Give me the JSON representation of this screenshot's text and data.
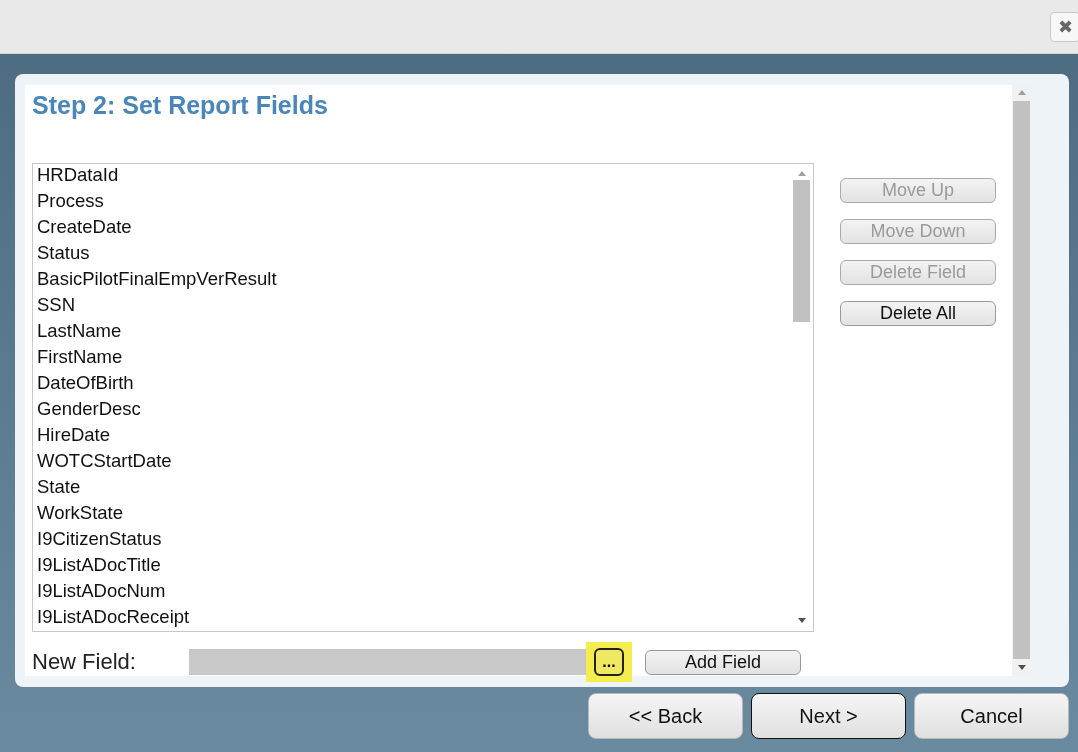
{
  "close_button": {
    "label": "✖"
  },
  "step_title": "Step 2: Set Report Fields",
  "fields_list": {
    "items": [
      {
        "label": "HRDataId",
        "selected": false
      },
      {
        "label": "Process",
        "selected": false
      },
      {
        "label": "CreateDate",
        "selected": false
      },
      {
        "label": "Status",
        "selected": false
      },
      {
        "label": "BasicPilotFinalEmpVerResult",
        "selected": false
      },
      {
        "label": "SSN",
        "selected": false
      },
      {
        "label": "LastName",
        "selected": false
      },
      {
        "label": "FirstName",
        "selected": false
      },
      {
        "label": "DateOfBirth",
        "selected": false
      },
      {
        "label": "GenderDesc",
        "selected": false
      },
      {
        "label": "HireDate",
        "selected": false
      },
      {
        "label": "WOTCStartDate",
        "selected": false
      },
      {
        "label": "State",
        "selected": false
      },
      {
        "label": "WorkState",
        "selected": false
      },
      {
        "label": "I9CitizenStatus",
        "selected": false
      },
      {
        "label": "I9ListADocTitle",
        "selected": false
      },
      {
        "label": "I9ListADocNum",
        "selected": false
      },
      {
        "label": "I9ListADocReceipt",
        "selected": false
      }
    ]
  },
  "side_buttons": [
    {
      "label": "Move Up",
      "disabled": true
    },
    {
      "label": "Move Down",
      "disabled": true
    },
    {
      "label": "Delete Field",
      "disabled": true
    },
    {
      "label": "Delete All",
      "disabled": false
    }
  ],
  "new_field": {
    "label": "New Field:",
    "browse_button": {
      "label": "...",
      "highlighted": true
    },
    "add_button": "Add Field"
  },
  "nav_buttons": [
    {
      "label": "<< Back",
      "selected": false
    },
    {
      "label": "Next >",
      "selected": true
    },
    {
      "label": "Cancel",
      "selected": false
    }
  ]
}
